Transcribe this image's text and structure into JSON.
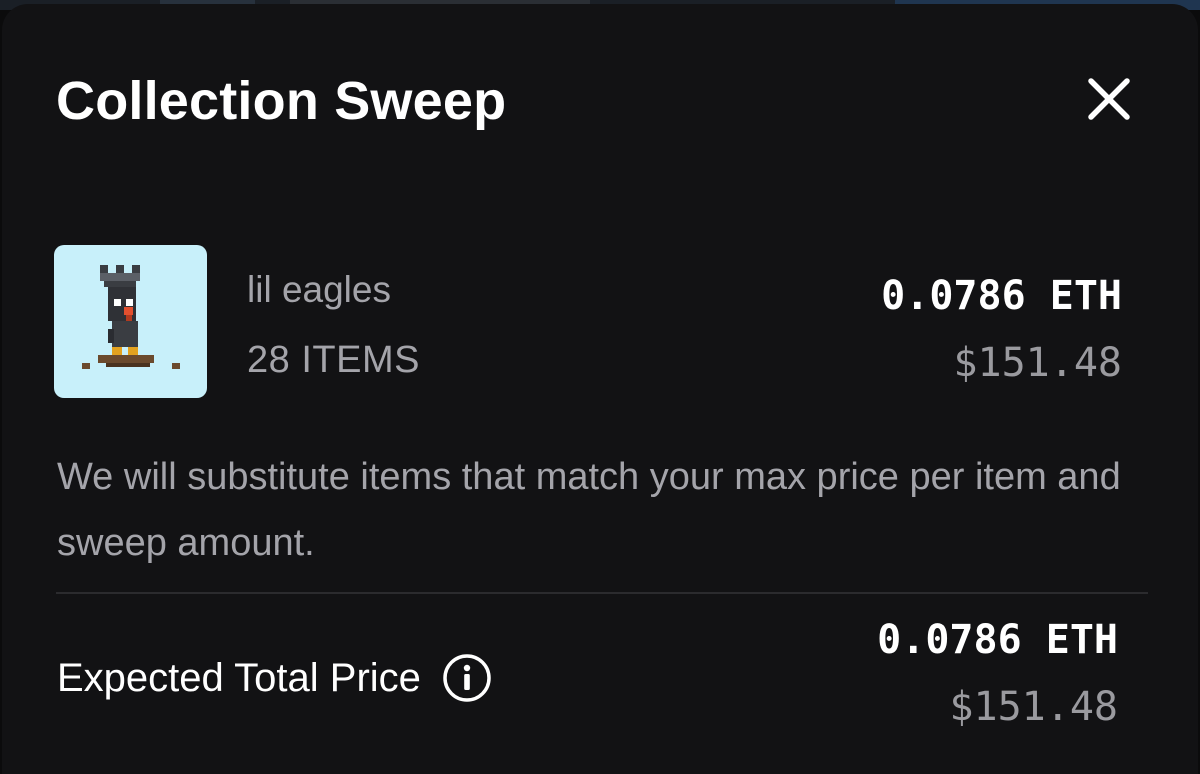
{
  "modal": {
    "title": "Collection Sweep"
  },
  "icons": {
    "close": "close-icon",
    "info": "info-icon",
    "collection_thumbnail": "pixel-eagle-avatar"
  },
  "item": {
    "collection_name": "lil eagles",
    "count_label": "28 ITEMS",
    "price_eth": "0.0786 ETH",
    "price_usd": "$151.48"
  },
  "note": "We will substitute items that match your max price per item and sweep amount.",
  "total": {
    "label": "Expected Total Price",
    "price_eth": "0.0786 ETH",
    "price_usd": "$151.48"
  },
  "colors": {
    "modal_background": "#121214",
    "thumbnail_background": "#c8f0fa",
    "primary_text": "#ffffff",
    "secondary_text": "#a4a4aa"
  }
}
